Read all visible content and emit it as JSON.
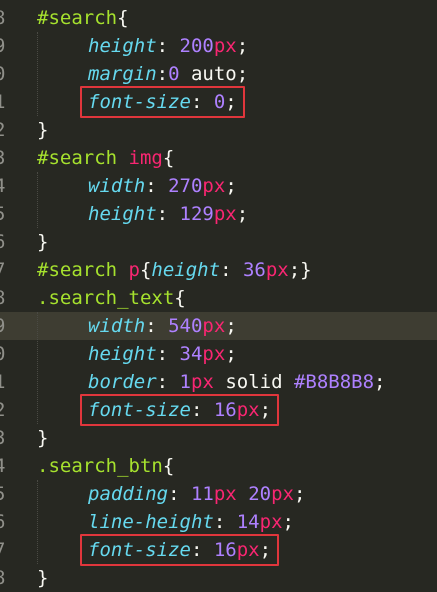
{
  "editor": {
    "lines": [
      {
        "n": "8",
        "segs": [
          [
            "sel",
            "#search"
          ],
          [
            "punc",
            "{"
          ]
        ]
      },
      {
        "n": "9",
        "indent": true,
        "segs": [
          [
            "prop",
            "height"
          ],
          [
            "punc",
            ": "
          ],
          [
            "num",
            "200"
          ],
          [
            "unit",
            "px"
          ],
          [
            "punc",
            ";"
          ]
        ]
      },
      {
        "n": "0",
        "indent": true,
        "segs": [
          [
            "prop",
            "margin"
          ],
          [
            "punc",
            ":"
          ],
          [
            "num",
            "0"
          ],
          [
            "val",
            " auto"
          ],
          [
            "punc",
            ";"
          ]
        ]
      },
      {
        "n": "1",
        "indent": true,
        "hl": true,
        "segs": [
          [
            "prop",
            "font-size"
          ],
          [
            "punc",
            ": "
          ],
          [
            "num",
            "0"
          ],
          [
            "punc",
            ";"
          ]
        ]
      },
      {
        "n": "2",
        "segs": [
          [
            "punc",
            "}"
          ]
        ]
      },
      {
        "n": "3",
        "segs": [
          [
            "sel",
            "#search "
          ],
          [
            "tag",
            "img"
          ],
          [
            "punc",
            "{"
          ]
        ]
      },
      {
        "n": "4",
        "indent": true,
        "segs": [
          [
            "prop",
            "width"
          ],
          [
            "punc",
            ": "
          ],
          [
            "num",
            "270"
          ],
          [
            "unit",
            "px"
          ],
          [
            "punc",
            ";"
          ]
        ]
      },
      {
        "n": "5",
        "indent": true,
        "segs": [
          [
            "prop",
            "height"
          ],
          [
            "punc",
            ": "
          ],
          [
            "num",
            "129"
          ],
          [
            "unit",
            "px"
          ],
          [
            "punc",
            ";"
          ]
        ]
      },
      {
        "n": "6",
        "segs": [
          [
            "punc",
            "}"
          ]
        ]
      },
      {
        "n": "7",
        "segs": [
          [
            "sel",
            "#search "
          ],
          [
            "tag",
            "p"
          ],
          [
            "punc",
            "{"
          ],
          [
            "prop",
            "height"
          ],
          [
            "punc",
            ": "
          ],
          [
            "num",
            "36"
          ],
          [
            "unit",
            "px"
          ],
          [
            "punc",
            ";}"
          ]
        ]
      },
      {
        "n": "8",
        "segs": [
          [
            "sel",
            ".search_text"
          ],
          [
            "punc",
            "{"
          ]
        ]
      },
      {
        "n": "9",
        "indent": true,
        "current": true,
        "segs": [
          [
            "prop",
            "width"
          ],
          [
            "punc",
            ": "
          ],
          [
            "num",
            "540"
          ],
          [
            "unit",
            "px"
          ],
          [
            "punc",
            ";"
          ]
        ]
      },
      {
        "n": "0",
        "indent": true,
        "segs": [
          [
            "prop",
            "height"
          ],
          [
            "punc",
            ": "
          ],
          [
            "num",
            "34"
          ],
          [
            "unit",
            "px"
          ],
          [
            "punc",
            ";"
          ]
        ]
      },
      {
        "n": "1",
        "indent": true,
        "segs": [
          [
            "prop",
            "border"
          ],
          [
            "punc",
            ": "
          ],
          [
            "num",
            "1"
          ],
          [
            "unit",
            "px"
          ],
          [
            "val",
            " solid "
          ],
          [
            "num",
            "#B8B8B8"
          ],
          [
            "punc",
            ";"
          ]
        ]
      },
      {
        "n": "2",
        "indent": true,
        "hl": true,
        "segs": [
          [
            "prop",
            "font-size"
          ],
          [
            "punc",
            ": "
          ],
          [
            "num",
            "16"
          ],
          [
            "unit",
            "px"
          ],
          [
            "punc",
            ";"
          ]
        ]
      },
      {
        "n": "3",
        "segs": [
          [
            "punc",
            "}"
          ]
        ]
      },
      {
        "n": "4",
        "segs": [
          [
            "sel",
            ".search_btn"
          ],
          [
            "punc",
            "{"
          ]
        ]
      },
      {
        "n": "5",
        "indent": true,
        "segs": [
          [
            "prop",
            "padding"
          ],
          [
            "punc",
            ": "
          ],
          [
            "num",
            "11"
          ],
          [
            "unit",
            "px"
          ],
          [
            "val",
            " "
          ],
          [
            "num",
            "20"
          ],
          [
            "unit",
            "px"
          ],
          [
            "punc",
            ";"
          ]
        ]
      },
      {
        "n": "6",
        "indent": true,
        "segs": [
          [
            "prop",
            "line-height"
          ],
          [
            "punc",
            ": "
          ],
          [
            "num",
            "14"
          ],
          [
            "unit",
            "px"
          ],
          [
            "punc",
            ";"
          ]
        ]
      },
      {
        "n": "7",
        "indent": true,
        "hl": true,
        "segs": [
          [
            "prop",
            "font-size"
          ],
          [
            "punc",
            ": "
          ],
          [
            "num",
            "16"
          ],
          [
            "unit",
            "px"
          ],
          [
            "punc",
            ";"
          ]
        ]
      },
      {
        "n": "8",
        "segs": [
          [
            "punc",
            "}"
          ]
        ]
      }
    ]
  },
  "colors": {
    "background": "#272822",
    "selector": "#a6e22e",
    "tag": "#f92672",
    "property": "#66d9ef",
    "number": "#ae81ff",
    "unit": "#f92672",
    "highlight_box": "#e0363c"
  }
}
